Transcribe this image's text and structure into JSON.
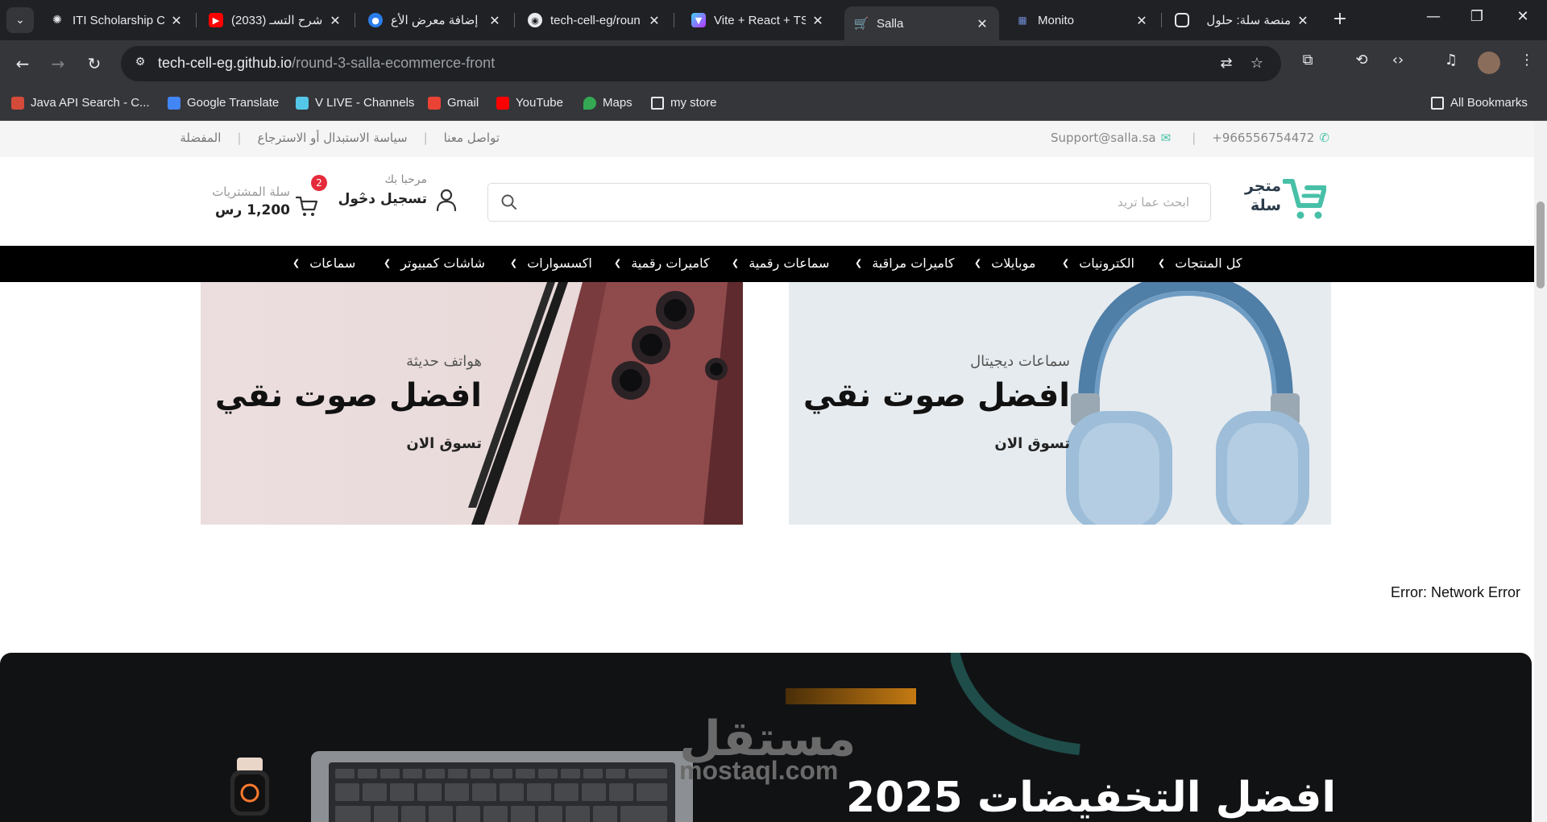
{
  "browser": {
    "tabs": [
      {
        "title": "ITI Scholarship C",
        "favicon": "openai-icon"
      },
      {
        "title": "(2033) شرح التسـ",
        "favicon": "youtube-icon"
      },
      {
        "title": "إضافة معرض الأع",
        "favicon": "circle-icon"
      },
      {
        "title": "tech-cell-eg/roun",
        "favicon": "github-icon"
      },
      {
        "title": "Vite + React + TS",
        "favicon": "vite-icon"
      },
      {
        "title": "Salla",
        "favicon": "cart-icon",
        "active": true
      },
      {
        "title": "Monito",
        "favicon": "monito-icon"
      },
      {
        "title": "منصة سلة: حلول",
        "favicon": "salla-icon"
      }
    ],
    "url_host": "tech-cell-eg.github.io",
    "url_path": "/round-3-salla-ecommerce-front",
    "bookmarks": [
      {
        "label": "Java API Search - C...",
        "color": "#d44b3a"
      },
      {
        "label": "Google Translate",
        "color": "#4285f4"
      },
      {
        "label": "V LIVE - Channels",
        "color": "#54c7e8"
      },
      {
        "label": "Gmail",
        "color": "#ea4335"
      },
      {
        "label": "YouTube",
        "color": "#ff0000"
      },
      {
        "label": "Maps",
        "color": "#34a853"
      },
      {
        "label": "my store",
        "color": "folder"
      }
    ],
    "all_bookmarks": "All Bookmarks"
  },
  "site": {
    "topbar": {
      "links": [
        "تواصل معنا",
        "سياسة الاستبدال أو الاسترجاع",
        "المفضلة"
      ],
      "email": "Support@salla.sa",
      "phone": "+966556754472"
    },
    "logo_text_line1": "متجر",
    "logo_text_line2": "سلة",
    "search_placeholder": "ابحث عما تريد",
    "welcome": "مرحبا بك",
    "login": "تسجيل دخول",
    "cart_label": "سلة المشتريات",
    "cart_total": "1,200 رس",
    "cart_count": "2",
    "categories": [
      "كل المنتجات",
      "الكترونيات",
      "موبايلات",
      "كاميرات مراقبة",
      "سماعات رقمية",
      "كاميرات رقمية",
      "اكسسوارات",
      "شاشات كمبيوتر",
      "سماعات"
    ],
    "banners": {
      "phones": {
        "kicker": "هواتف حديثة",
        "headline": "افضل صوت نقي",
        "cta": "تسوق الان"
      },
      "headphones": {
        "kicker": "سماعات ديجيتال",
        "headline": "افضل صوت نقي",
        "cta": "تسوق الان"
      }
    },
    "error": "Error: Network Error",
    "promo": {
      "watermark_ar": "مستقل",
      "watermark_en": "mostaql.com",
      "title": "افضل التخفيضات 2025"
    }
  },
  "colors": {
    "accent": "#48c0a8",
    "badge": "#e52b3b",
    "nav_bg": "#000000"
  }
}
